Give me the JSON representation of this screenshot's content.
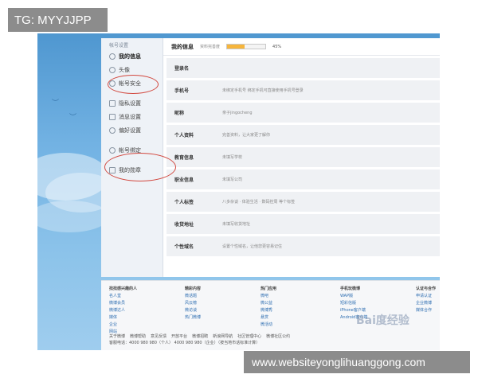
{
  "overlay": {
    "top_left": "TG: MYYJJPP",
    "bottom_right": "www.websiteyonglihuanggong.com"
  },
  "sidebar": {
    "header": "帐号设置",
    "items": [
      {
        "label": "我的信息",
        "icon": "person-icon"
      },
      {
        "label": "头像",
        "icon": "avatar-icon"
      },
      {
        "label": "帐号安全",
        "icon": "lock-icon"
      },
      {
        "label": "隐私设置",
        "icon": "privacy-icon"
      },
      {
        "label": "消息设置",
        "icon": "message-icon"
      },
      {
        "label": "偏好设置",
        "icon": "preference-icon"
      },
      {
        "label": "帐号绑定",
        "icon": "link-icon"
      },
      {
        "label": "我的勋章",
        "icon": "medal-icon"
      }
    ]
  },
  "main": {
    "title": "我的信息",
    "completeness_label": "资料完善度",
    "completeness_pct": "45%",
    "completeness_value": 45,
    "rows": [
      {
        "key": "登录名",
        "value": ""
      },
      {
        "key": "手机号",
        "value": "未绑定手机号 绑定手机可直接使用手机号登录"
      },
      {
        "key": "昵称",
        "value": "亲子jingocheng"
      },
      {
        "key": "个人资料",
        "value": "完善资料，让大家更了解你"
      },
      {
        "key": "教育信息",
        "value": "未填写学校"
      },
      {
        "key": "职业信息",
        "value": "未填写公司"
      },
      {
        "key": "个人标签",
        "value": "八多杂谈 · 体验生活 · 数码控周 等个标签"
      },
      {
        "key": "收货地址",
        "value": "未填写收货地址"
      },
      {
        "key": "个性域名",
        "value": "设置个性域名，让他您更容易记住"
      }
    ]
  },
  "footer": {
    "columns": [
      {
        "heading": "找找感兴趣的人",
        "links": [
          "名人堂",
          "微博会员",
          "微博达人",
          "媒体",
          "企业",
          "网站"
        ]
      },
      {
        "heading": "精彩内容",
        "links": [
          "微话题",
          "风云榜",
          "微访谈",
          "热门微博"
        ]
      },
      {
        "heading": "热门应用",
        "links": [
          "微吧",
          "微公益",
          "微博秀",
          "悬赏",
          "微活动"
        ]
      },
      {
        "heading": "手机玩微博",
        "links": [
          "WAP版",
          "短彩信版",
          "iPhone客户端",
          "Android客户端"
        ]
      },
      {
        "heading": "认证与合作",
        "links": [
          "申请认证",
          "企业微博",
          "媒体合作"
        ]
      }
    ],
    "bottom_links": [
      "关于微博",
      "微博帮助",
      "意见反馈",
      "开放平台",
      "微博招聘",
      "新浪网导航",
      "社区管理中心",
      "微博社区公约"
    ],
    "hotline": "客服电话：4000 980 980（个人） 4000 980 980（企业）（按当地市话标准计算）"
  },
  "watermark": "Bai度经验"
}
